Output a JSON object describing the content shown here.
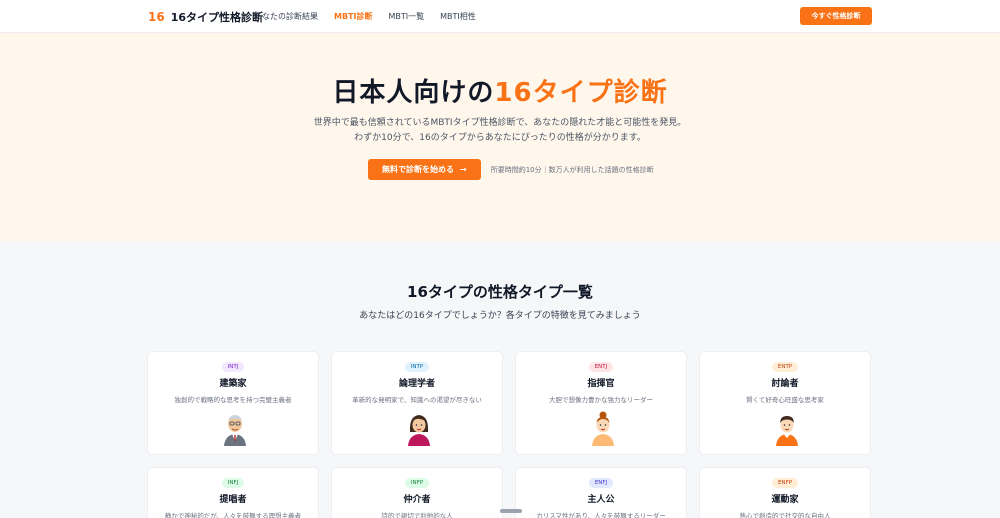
{
  "header": {
    "logo_mark": "16",
    "logo_text": "16タイプ性格診断",
    "nav": [
      "あなたの診断結果",
      "MBTI診断",
      "MBTI一覧",
      "MBTI相性"
    ],
    "cta": "今すぐ性格診断"
  },
  "hero": {
    "title_main": "日本人向けの",
    "title_accent": "16タイプ診断",
    "desc_line1": "世界中で最も信頼されているMBTIタイプ性格診断で、あなたの隠れた才能と可能性を発見。",
    "desc_line2": "わずか10分で、16のタイプからあなたにぴったりの性格が分かります。",
    "cta": "無料で診断を始める",
    "cta_arrow": "→",
    "note": "所要時間約10分｜数万人が利用した話題の性格診断"
  },
  "types_section": {
    "title": "16タイプの性格タイプ一覧",
    "subtitle": "あなたはどの16タイプでしょうか？各タイプの特徴を見てみましょう",
    "cards": [
      {
        "code": "INTJ",
        "name": "建築家",
        "desc": "独創的で戦略的な思考を持つ完璧主義者",
        "avatar": "old-man-glasses-avatar"
      },
      {
        "code": "INTP",
        "name": "論理学者",
        "desc": "革新的な発明家で、知識への渇望が尽きない",
        "avatar": "woman-avatar"
      },
      {
        "code": "ENTJ",
        "name": "指揮官",
        "desc": "大胆で想像力豊かな強力なリーダー",
        "avatar": "woman-bun-avatar"
      },
      {
        "code": "ENTP",
        "name": "討論者",
        "desc": "賢くて好奇心旺盛な思考家",
        "avatar": "man-avatar"
      },
      {
        "code": "INFJ",
        "name": "提唱者",
        "desc": "静かで神秘的だが、人々を鼓舞する理想主義者"
      },
      {
        "code": "INFP",
        "name": "仲介者",
        "desc": "詩的で親切で利他的な人"
      },
      {
        "code": "ENFJ",
        "name": "主人公",
        "desc": "カリスマ性があり、人々を鼓舞するリーダー"
      },
      {
        "code": "ENFP",
        "name": "運動家",
        "desc": "熱心で創造的で社交的な自由人"
      }
    ]
  },
  "colors": {
    "accent": "#f97316",
    "hero_bg": "#fff6ec"
  }
}
